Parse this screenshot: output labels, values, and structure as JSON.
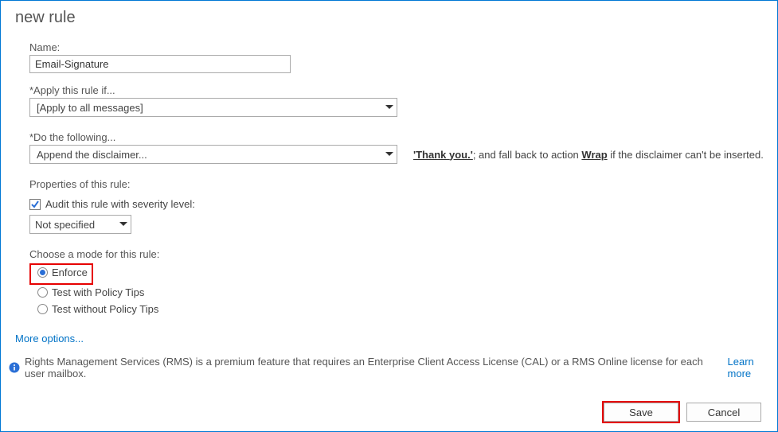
{
  "title": "new rule",
  "name": {
    "label": "Name:",
    "value": "Email-Signature"
  },
  "condition": {
    "label": "*Apply this rule if...",
    "selected": "[Apply to all messages]"
  },
  "action": {
    "label": "*Do the following...",
    "selected": "Append the disclaimer...",
    "side_thank_you": "'Thank you.'",
    "side_text1": "; and fall back to action ",
    "side_wrap": "Wrap",
    "side_text2": " if the disclaimer can't be inserted."
  },
  "properties_label": "Properties of this rule:",
  "audit": {
    "label": "Audit this rule with severity level:",
    "checked": true,
    "level": "Not specified"
  },
  "mode": {
    "label": "Choose a mode for this rule:",
    "options": {
      "enforce": "Enforce",
      "test_tips": "Test with Policy Tips",
      "test_notips": "Test without Policy Tips"
    },
    "selected": "enforce"
  },
  "more_options": "More options...",
  "rms_notice": "Rights Management Services (RMS) is a premium feature that requires an Enterprise Client Access License (CAL) or a RMS Online license for each user mailbox.",
  "learn_more": "Learn more",
  "buttons": {
    "save": "Save",
    "cancel": "Cancel"
  }
}
